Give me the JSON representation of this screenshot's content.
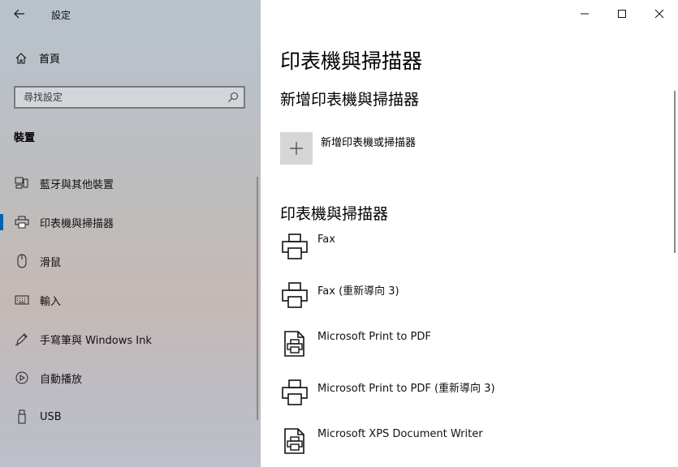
{
  "app": {
    "title": "設定",
    "back_label": "←"
  },
  "window_controls": {
    "minimize": "—",
    "maximize": "☐",
    "close": "✕"
  },
  "sidebar": {
    "home_label": "首頁",
    "search_placeholder": "尋找設定",
    "section_title": "裝置",
    "items": [
      {
        "label": "藍牙與其他裝置",
        "icon": "bluetooth-devices-icon"
      },
      {
        "label": "印表機與掃描器",
        "icon": "printer-icon",
        "active": true
      },
      {
        "label": "滑鼠",
        "icon": "mouse-icon"
      },
      {
        "label": "輸入",
        "icon": "keyboard-icon"
      },
      {
        "label": "手寫筆與 Windows Ink",
        "icon": "pen-icon"
      },
      {
        "label": "自動播放",
        "icon": "autoplay-icon"
      },
      {
        "label": "USB",
        "icon": "usb-icon"
      }
    ]
  },
  "main": {
    "page_title": "印表機與掃描器",
    "add_section_title": "新增印表機與掃描器",
    "add_button_label": "新增印表機或掃描器",
    "list_section_title": "印表機與掃描器",
    "printers": [
      {
        "name": "Fax",
        "icon": "printer-icon"
      },
      {
        "name": "Fax (重新導向 3)",
        "icon": "printer-icon"
      },
      {
        "name": "Microsoft Print to PDF",
        "icon": "pdf-printer-icon"
      },
      {
        "name": "Microsoft Print to PDF (重新導向 3)",
        "icon": "printer-icon"
      },
      {
        "name": "Microsoft XPS Document Writer",
        "icon": "pdf-printer-icon"
      }
    ]
  },
  "colors": {
    "accent": "#0063b1",
    "add_tile": "#d6d6d6"
  }
}
